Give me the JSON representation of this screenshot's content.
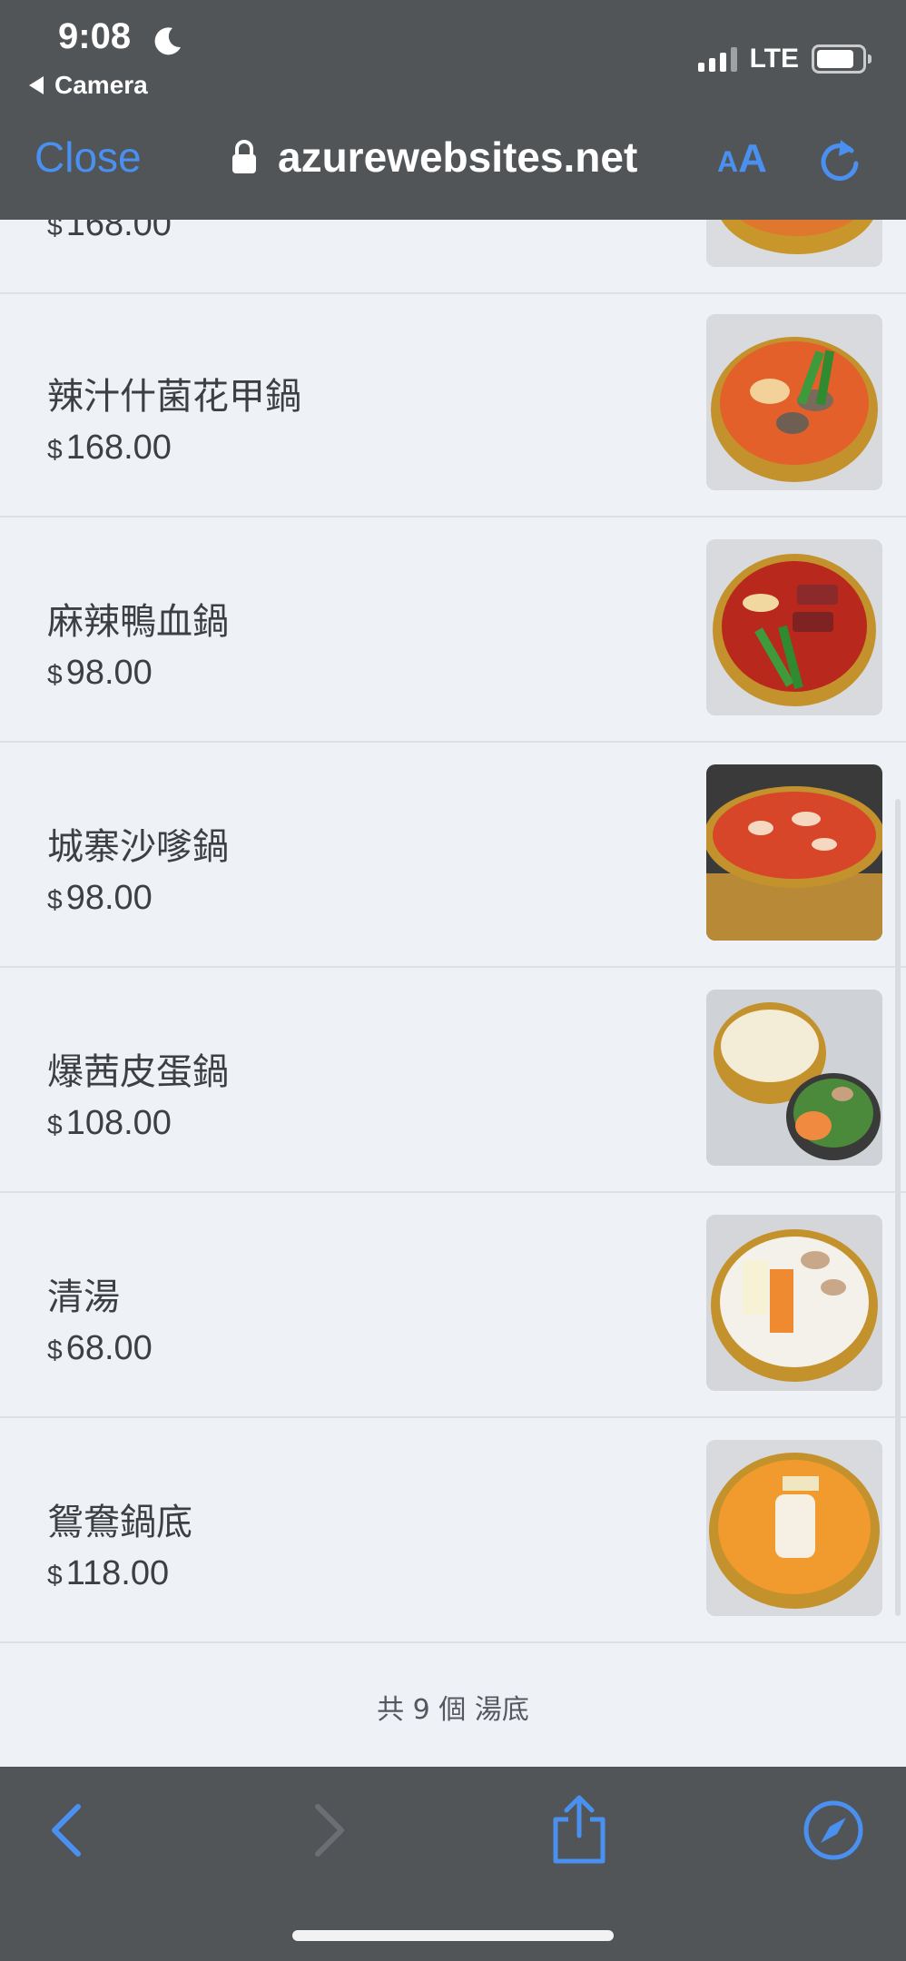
{
  "status_bar": {
    "time": "9:08",
    "back_app": "Camera",
    "network": "LTE"
  },
  "browser": {
    "close_label": "Close",
    "url": "azurewebsites.net",
    "aa_small": "A",
    "aa_big": "A"
  },
  "partial_item": {
    "price": "168.00"
  },
  "menu": {
    "currency": "$",
    "items": [
      {
        "name": "辣汁什菌花甲鍋",
        "price": "168.00"
      },
      {
        "name": "麻辣鴨血鍋",
        "price": "98.00"
      },
      {
        "name": "城寨沙嗲鍋",
        "price": "98.00"
      },
      {
        "name": "爆茜皮蛋鍋",
        "price": "108.00"
      },
      {
        "name": "清湯",
        "price": "68.00"
      },
      {
        "name": "鴛鴦鍋底",
        "price": "118.00"
      }
    ]
  },
  "footer": {
    "count_text": "共 9 個 湯底"
  },
  "colors": {
    "accent": "#4a90f0",
    "chrome": "#515558",
    "background": "#eef1f5"
  }
}
